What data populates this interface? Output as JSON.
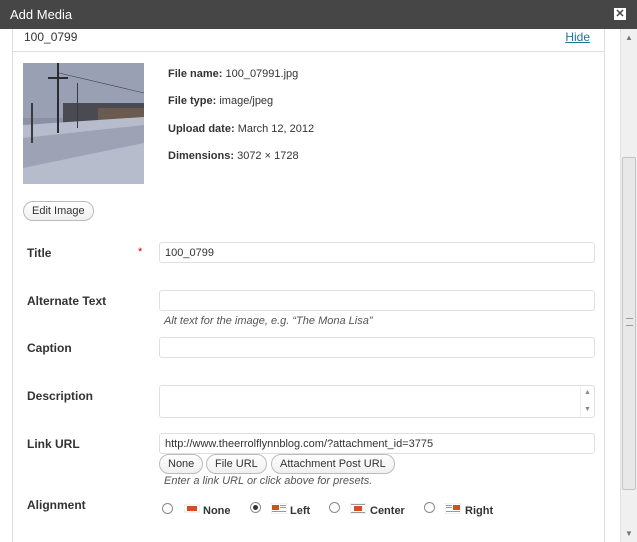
{
  "window": {
    "title": "Add Media",
    "close_glyph": "✕"
  },
  "item": {
    "name": "100_0799",
    "hide_label": "Hide",
    "file_name_label": "File name:",
    "file_name": "100_07991.jpg",
    "file_type_label": "File type:",
    "file_type": "image/jpeg",
    "upload_date_label": "Upload date:",
    "upload_date": "March 12, 2012",
    "dimensions_label": "Dimensions:",
    "dimensions": "3072 × 1728",
    "edit_image_label": "Edit Image"
  },
  "form": {
    "title_label": "Title",
    "required_mark": "*",
    "title_value": "100_0799",
    "alt_label": "Alternate Text",
    "alt_value": "",
    "alt_help": "Alt text for the image, e.g. “The Mona Lisa”",
    "caption_label": "Caption",
    "caption_value": "",
    "description_label": "Description",
    "link_label": "Link URL",
    "link_value": "http://www.theerrolflynnblog.com/?attachment_id=3775",
    "link_buttons": [
      "None",
      "File URL",
      "Attachment Post URL"
    ],
    "link_help": "Enter a link URL or click above for presets.",
    "alignment_label": "Alignment",
    "alignment_options": [
      "None",
      "Left",
      "Center",
      "Right"
    ],
    "alignment_selected": "Left"
  },
  "icons": [
    "close-icon",
    "align-none-icon",
    "align-left-icon",
    "align-center-icon",
    "align-right-icon",
    "scroll-up-icon",
    "scroll-down-icon"
  ]
}
